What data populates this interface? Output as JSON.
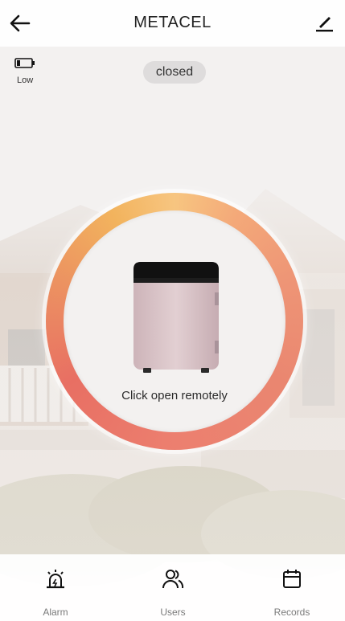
{
  "header": {
    "title": "METACEL"
  },
  "battery": {
    "label": "Low"
  },
  "lock": {
    "status": "closed",
    "action_label": "Click open remotely"
  },
  "tabs": [
    {
      "label": "Alarm",
      "icon": "alarm-icon"
    },
    {
      "label": "Users",
      "icon": "users-icon"
    },
    {
      "label": "Records",
      "icon": "calendar-icon"
    }
  ],
  "colors": {
    "ring_start": "#f7c580",
    "ring_end": "#e86f63",
    "badge_bg": "#dedcdc",
    "tab_label": "#7a7a7a"
  }
}
